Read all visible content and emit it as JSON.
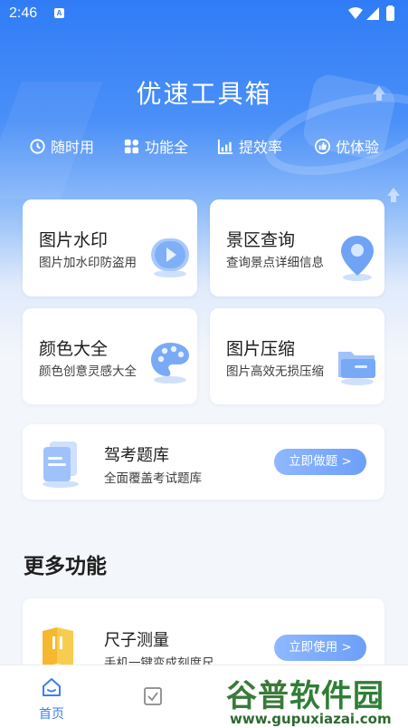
{
  "status_bar": {
    "time": "2:46",
    "notification_badge": "A"
  },
  "app": {
    "title": "优速工具箱"
  },
  "features": [
    {
      "label": "随时用",
      "icon": "clock-refresh-icon"
    },
    {
      "label": "功能全",
      "icon": "grid-icon"
    },
    {
      "label": "提效率",
      "icon": "bar-chart-icon"
    },
    {
      "label": "优体验",
      "icon": "thumbs-up-icon"
    }
  ],
  "tools": [
    {
      "title": "图片水印",
      "subtitle": "图片加水印防盗用",
      "icon": "play-circle-icon"
    },
    {
      "title": "景区查询",
      "subtitle": "查询景点详细信息",
      "icon": "location-pin-icon"
    },
    {
      "title": "颜色大全",
      "subtitle": "颜色创意灵感大全",
      "icon": "palette-icon"
    },
    {
      "title": "图片压缩",
      "subtitle": "图片高效无损压缩",
      "icon": "folder-icon"
    }
  ],
  "exam": {
    "title": "驾考题库",
    "subtitle": "全面覆盖考试题库",
    "button": "立即做题 >",
    "icon": "document-stack-icon"
  },
  "more": {
    "section_title": "更多功能",
    "items": [
      {
        "title": "尺子测量",
        "subtitle": "手机一键变成刻度尺",
        "button": "立即使用 >",
        "icon": "ruler-book-icon"
      }
    ]
  },
  "tabbar": {
    "tabs": [
      {
        "label": "首页",
        "icon": "home-icon",
        "active": true
      },
      {
        "label": "",
        "icon": "checkbox-icon",
        "active": false
      }
    ]
  },
  "watermark": {
    "text_a": "谷普",
    "text_b": "软件园",
    "url": "www.gupuxiazai.com"
  },
  "colors": {
    "primary": "#2f7cf6",
    "accent_button": "#7aa8f8",
    "background": "#f3f6fb"
  }
}
